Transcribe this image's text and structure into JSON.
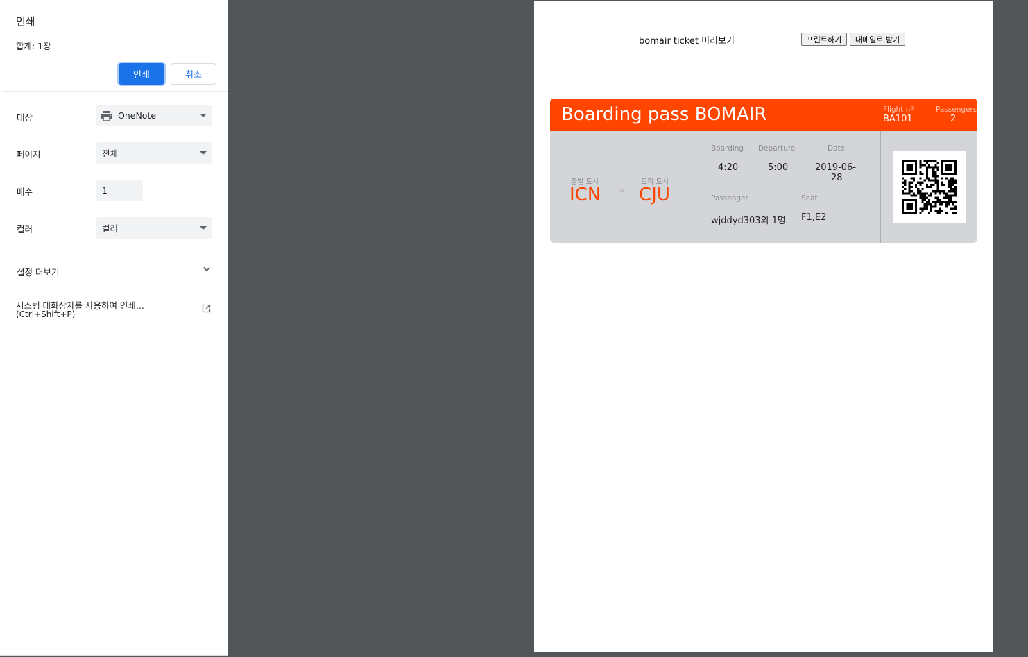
{
  "dialog": {
    "title": "인쇄",
    "total_sheets": "합계: 1장",
    "print_label": "인쇄",
    "cancel_label": "취소",
    "rows": {
      "destination": {
        "label": "대상",
        "value": "OneNote",
        "icon": "printer-icon"
      },
      "pages": {
        "label": "페이지",
        "value": "전체"
      },
      "copies": {
        "label": "매수",
        "value": "1"
      },
      "color": {
        "label": "컬러",
        "value": "컬러"
      }
    },
    "more_settings_label": "설정 더보기",
    "system_dialog_label": "시스템 대화상자를 사용하여 인쇄...",
    "system_dialog_shortcut": "(Ctrl+Shift+P)"
  },
  "preview": {
    "heading": "bomair ticket 미리보기",
    "print_button": "프린트하기",
    "email_button": "내메일로 받기",
    "pass": {
      "title": "Boarding pass BOMAIR",
      "flight_label": "Flight nº",
      "flight_value": "BA101",
      "passengers_label": "Passengers",
      "passengers_value": "2",
      "from_label": "출발 도시",
      "from_code": "ICN",
      "to_text": "to",
      "to_label": "도착 도시",
      "to_code": "CJU",
      "boarding_label": "Boarding",
      "boarding_value": "4:20",
      "departure_label": "Departure",
      "departure_value": "5:00",
      "date_label": "Date",
      "date_value_line1": "2019-06-",
      "date_value_line2": "28",
      "passenger_label": "Passenger",
      "passenger_value": "wjddyd303외 1명",
      "seat_label": "Seat",
      "seat_value": "F1,E2"
    }
  },
  "colors": {
    "accent_blue": "#1a73e8",
    "pass_orange": "#ff4500",
    "preview_background": "#525659"
  }
}
